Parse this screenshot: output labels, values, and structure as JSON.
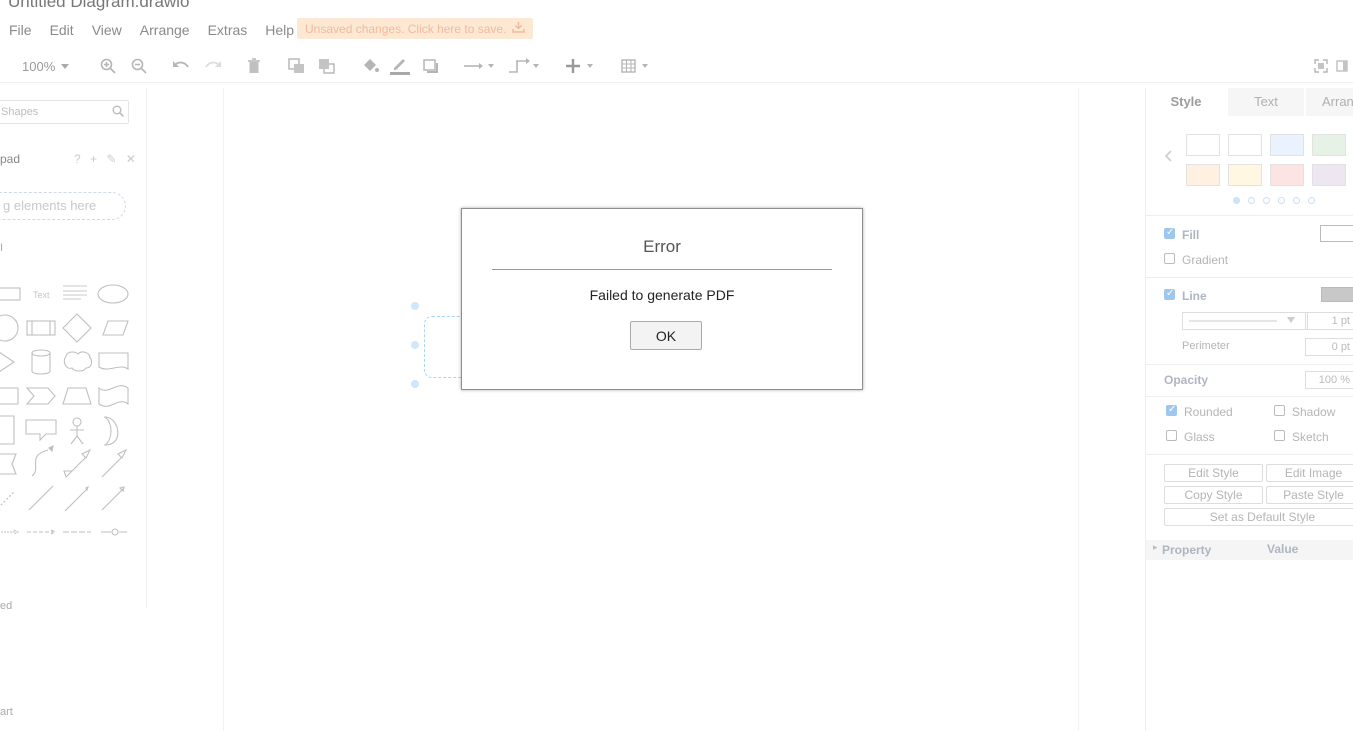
{
  "app": {
    "title": "Untitled Diagram.drawio",
    "menu": [
      "File",
      "Edit",
      "View",
      "Arrange",
      "Extras",
      "Help"
    ],
    "unsaved_notice": "Unsaved changes. Click here to save."
  },
  "toolbar": {
    "zoom": "100%",
    "icons": [
      "zoom-in-icon",
      "zoom-out-icon",
      "undo-icon",
      "redo-icon",
      "delete-icon",
      "to-front-icon",
      "to-back-icon",
      "fill-color-icon",
      "line-color-icon",
      "shadow-icon",
      "connection-icon",
      "waypoints-icon",
      "insert-icon",
      "table-icon",
      "fullscreen-icon",
      "format-panel-icon"
    ]
  },
  "sidebar": {
    "search_placeholder": "Shapes",
    "scratchpad_label": "pad",
    "scratchpad_tools": "? + ✎ ✕",
    "drop_hint": "g elements here",
    "general_label": "I",
    "text_shape_label": "Text",
    "bottom_label_1": "ed",
    "bottom_label_2": "art"
  },
  "dialog": {
    "title": "Error",
    "message": "Failed to generate PDF",
    "ok_label": "OK"
  },
  "format_panel": {
    "tabs": [
      "Style",
      "Text",
      "Arrange"
    ],
    "swatch_colors": [
      "#ffffff",
      "#ffffff",
      "#dae8fc",
      "#d5e8d4",
      "#ffe6cc",
      "#fff2cc",
      "#f8cecc",
      "#e1d5e7"
    ],
    "fill_label": "Fill",
    "gradient_label": "Gradient",
    "line_label": "Line",
    "line_width": "1 pt",
    "perimeter_label": "Perimeter",
    "perimeter_value": "0 pt",
    "opacity_label": "Opacity",
    "opacity_value": "100 %",
    "rounded_label": "Rounded",
    "shadow_label": "Shadow",
    "glass_label": "Glass",
    "sketch_label": "Sketch",
    "edit_style": "Edit Style",
    "edit_image": "Edit Image",
    "copy_style": "Copy Style",
    "paste_style": "Paste Style",
    "set_default": "Set as Default Style",
    "property_header": "Property",
    "value_header": "Value",
    "fill_checked": true,
    "line_checked": true,
    "rounded_checked": true
  }
}
